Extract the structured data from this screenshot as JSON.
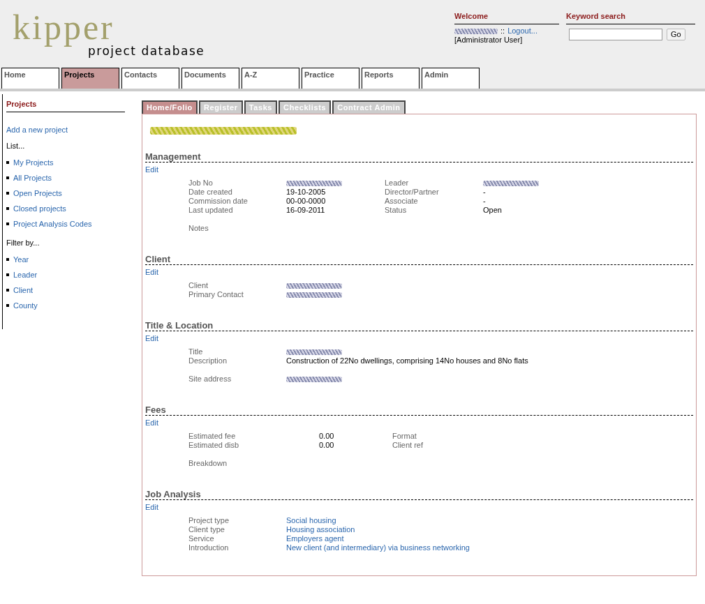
{
  "logo": {
    "name": "kipper",
    "subtitle": "project database"
  },
  "welcome": {
    "title": "Welcome",
    "user_blurred": true,
    "separator": "::",
    "logout": "Logout...",
    "role": "[Administrator User]"
  },
  "search": {
    "title": "Keyword search",
    "button": "Go"
  },
  "nav": [
    {
      "label": "Home",
      "selected": false
    },
    {
      "label": "Projects",
      "selected": true
    },
    {
      "label": "Contacts",
      "selected": false
    },
    {
      "label": "Documents",
      "selected": false
    },
    {
      "label": "A-Z",
      "selected": false
    },
    {
      "label": "Practice",
      "selected": false
    },
    {
      "label": "Reports",
      "selected": false
    },
    {
      "label": "Admin",
      "selected": false
    }
  ],
  "sidebar": {
    "title": "Projects",
    "add": "Add a new project",
    "groups": [
      {
        "heading": "List...",
        "items": [
          "My Projects",
          "All Projects",
          "Open Projects",
          "Closed projects",
          "Project Analysis Codes"
        ]
      },
      {
        "heading": "Filter by...",
        "items": [
          "Year",
          "Leader",
          "Client",
          "County"
        ]
      }
    ]
  },
  "tabs": [
    {
      "label": "Home/Folio",
      "selected": true
    },
    {
      "label": "Register",
      "selected": false
    },
    {
      "label": "Tasks",
      "selected": false
    },
    {
      "label": "Checklists",
      "selected": false
    },
    {
      "label": "Contract Admin",
      "selected": false
    }
  ],
  "project_title_blurred": true,
  "sections": [
    {
      "title": "Management",
      "edit": "Edit",
      "kind": "wide",
      "rows": [
        {
          "cells": [
            {
              "text": "Job No",
              "kind": "label"
            },
            {
              "kind": "blurred"
            },
            {
              "text": "Leader",
              "kind": "label"
            },
            {
              "kind": "blurred"
            }
          ]
        },
        {
          "cells": [
            {
              "text": "Date created",
              "kind": "label"
            },
            {
              "text": "19-10-2005",
              "kind": "value"
            },
            {
              "text": "Director/Partner",
              "kind": "label"
            },
            {
              "text": "-",
              "kind": "value"
            }
          ]
        },
        {
          "cells": [
            {
              "text": "Commission date",
              "kind": "label"
            },
            {
              "text": "00-00-0000",
              "kind": "value"
            },
            {
              "text": "Associate",
              "kind": "label"
            },
            {
              "text": "-",
              "kind": "value"
            }
          ]
        },
        {
          "cells": [
            {
              "text": "Last updated",
              "kind": "label"
            },
            {
              "text": "16-09-2011",
              "kind": "value"
            },
            {
              "text": "Status",
              "kind": "label"
            },
            {
              "text": "Open",
              "kind": "value"
            }
          ]
        },
        {
          "gap_before": true,
          "cells": [
            {
              "text": "Notes",
              "kind": "label"
            }
          ]
        }
      ]
    },
    {
      "title": "Client",
      "edit": "Edit",
      "kind": "wide",
      "rows": [
        {
          "cells": [
            {
              "text": "Client",
              "kind": "label"
            },
            {
              "kind": "blurred"
            }
          ]
        },
        {
          "cells": [
            {
              "text": "Primary Contact",
              "kind": "label"
            },
            {
              "kind": "blurred"
            }
          ]
        }
      ]
    },
    {
      "title": "Title & Location",
      "edit": "Edit",
      "kind": "wide",
      "rows": [
        {
          "cells": [
            {
              "text": "Title",
              "kind": "label"
            },
            {
              "kind": "blurred"
            }
          ]
        },
        {
          "cells": [
            {
              "text": "Description",
              "kind": "label"
            },
            {
              "text": "Construction of 22No dwellings, comprising 14No houses and 8No flats",
              "kind": "value"
            }
          ]
        },
        {
          "gap_before": true,
          "cells": [
            {
              "text": "Site address",
              "kind": "label"
            },
            {
              "kind": "blurred"
            }
          ]
        }
      ]
    },
    {
      "title": "Fees",
      "edit": "Edit",
      "kind": "narrow",
      "rows": [
        {
          "cells": [
            {
              "text": "Estimated fee",
              "kind": "label"
            },
            {
              "text": "0.00",
              "kind": "value"
            },
            {
              "text": "Format",
              "kind": "label"
            }
          ]
        },
        {
          "cells": [
            {
              "text": "Estimated disb",
              "kind": "label"
            },
            {
              "text": "0.00",
              "kind": "value"
            },
            {
              "text": "Client ref",
              "kind": "label"
            }
          ]
        },
        {
          "gap_before": true,
          "cells": [
            {
              "text": "Breakdown",
              "kind": "label"
            }
          ]
        }
      ]
    },
    {
      "title": "Job Analysis",
      "edit": "Edit",
      "kind": "wide",
      "rows": [
        {
          "cells": [
            {
              "text": "Project type",
              "kind": "label"
            },
            {
              "text": "Social housing",
              "kind": "link"
            }
          ]
        },
        {
          "cells": [
            {
              "text": "Client type",
              "kind": "label"
            },
            {
              "text": "Housing association",
              "kind": "link"
            }
          ]
        },
        {
          "cells": [
            {
              "text": "Service",
              "kind": "label"
            },
            {
              "text": "Employers agent",
              "kind": "link"
            }
          ]
        },
        {
          "cells": [
            {
              "text": "Introduction",
              "kind": "label"
            },
            {
              "text": "New client (and intermediary) via business networking",
              "kind": "link"
            }
          ]
        }
      ]
    }
  ]
}
